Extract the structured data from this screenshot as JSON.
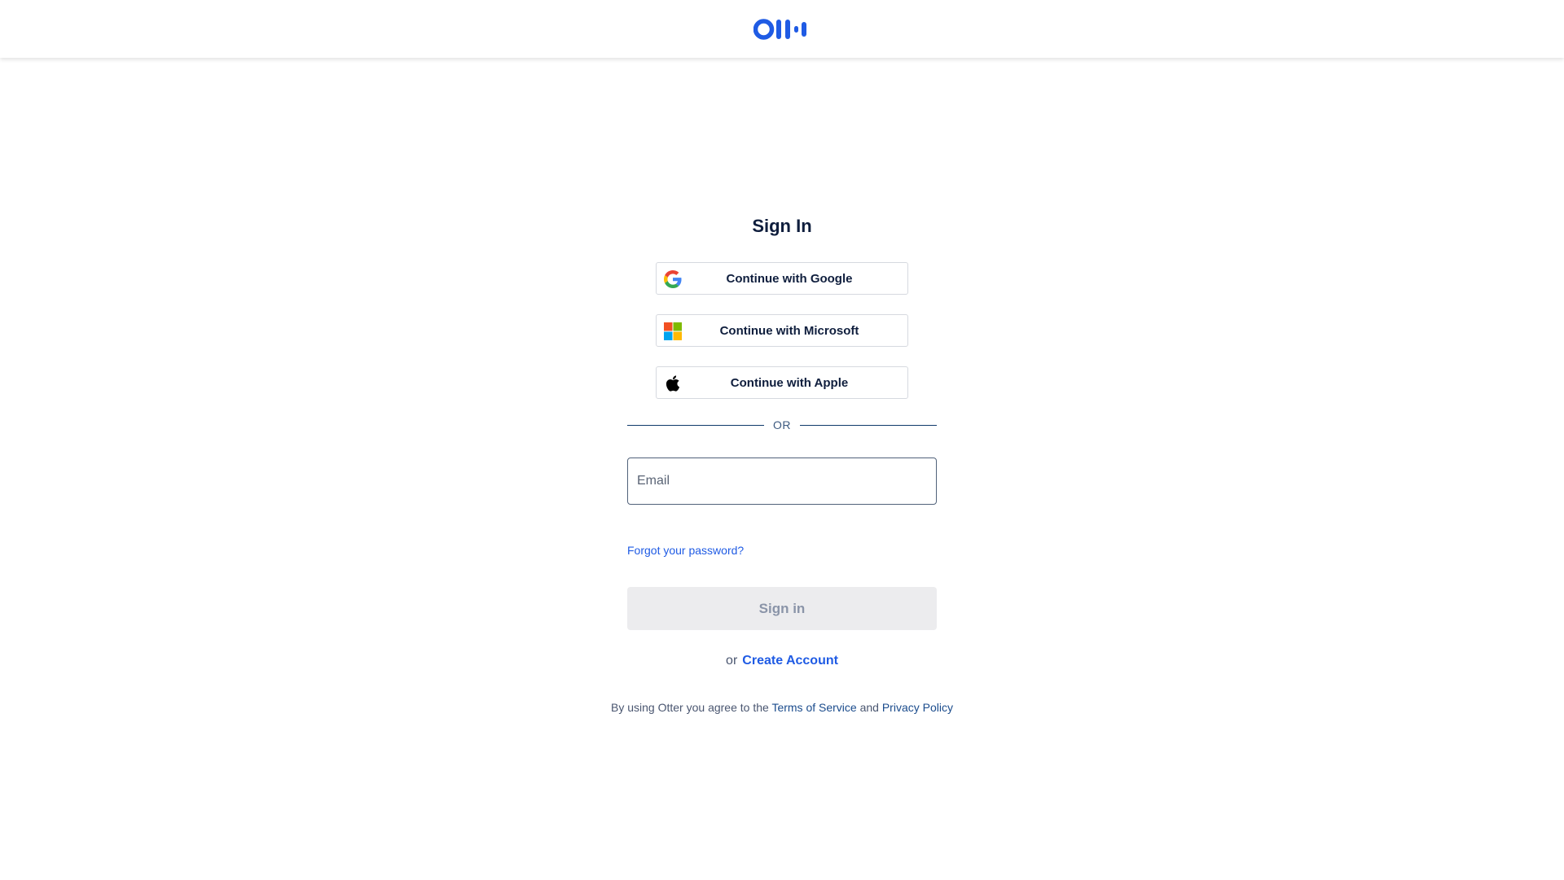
{
  "header": {
    "logo_name": "otter-logo",
    "brand_color": "#1f5be4"
  },
  "signin": {
    "title": "Sign In",
    "google_label": "Continue with Google",
    "microsoft_label": "Continue with Microsoft",
    "apple_label": "Continue with Apple",
    "or_divider": "OR",
    "email_placeholder": "Email",
    "email_value": "",
    "forgot_password": "Forgot your password?",
    "submit_label": "Sign in",
    "create_prefix": "or",
    "create_account": "Create Account"
  },
  "legal": {
    "prefix": "By using Otter you agree to the",
    "terms": "Terms of Service",
    "conjunction": "and",
    "privacy": "Privacy Policy"
  },
  "icons": {
    "google": "google-icon",
    "microsoft": "microsoft-icon",
    "apple": "apple-icon"
  }
}
